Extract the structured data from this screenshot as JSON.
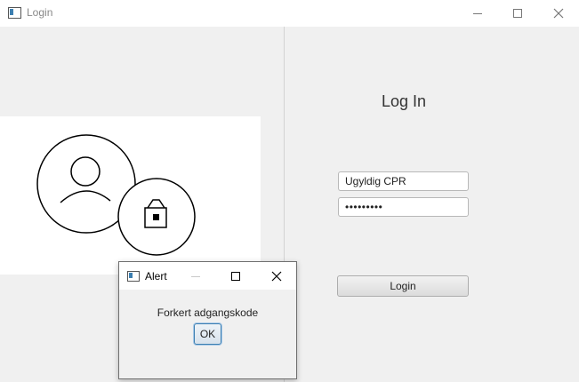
{
  "window": {
    "title": "Login",
    "controls": {
      "minimize": "minimize-icon",
      "maximize": "maximize-icon",
      "close": "close-icon"
    }
  },
  "login": {
    "heading": "Log In",
    "cpr_value": "Ugyldig CPR",
    "password_value": "•••••••••",
    "button_label": "Login"
  },
  "image": {
    "icon": "user-lock-icon"
  },
  "alert": {
    "title": "Alert",
    "message": "Forkert adgangskode",
    "ok_label": "OK"
  },
  "colors": {
    "accent": "#3c7fb1",
    "divider": "#d3d3d3",
    "background": "#f0f0f0"
  }
}
